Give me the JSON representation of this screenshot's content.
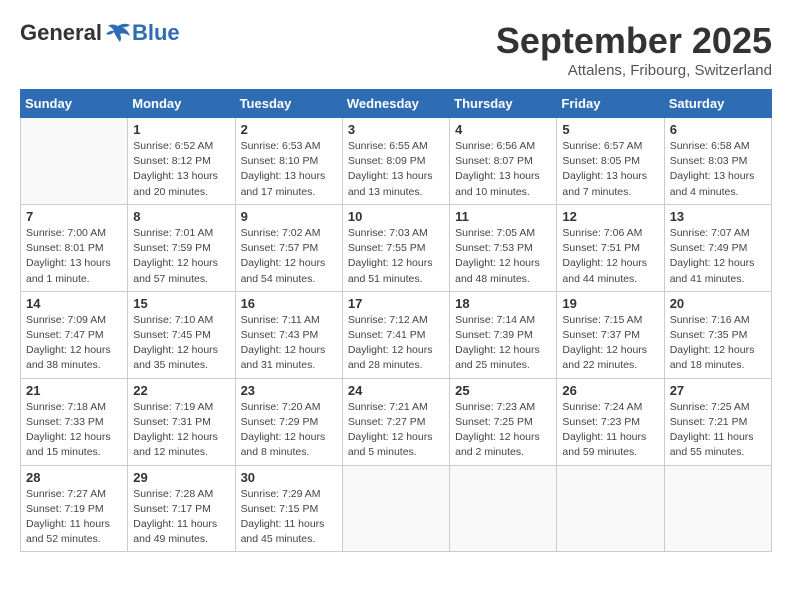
{
  "logo": {
    "general": "General",
    "blue": "Blue"
  },
  "title": "September 2025",
  "subtitle": "Attalens, Fribourg, Switzerland",
  "days_of_week": [
    "Sunday",
    "Monday",
    "Tuesday",
    "Wednesday",
    "Thursday",
    "Friday",
    "Saturday"
  ],
  "weeks": [
    [
      {
        "day": "",
        "info": ""
      },
      {
        "day": "1",
        "info": "Sunrise: 6:52 AM\nSunset: 8:12 PM\nDaylight: 13 hours\nand 20 minutes."
      },
      {
        "day": "2",
        "info": "Sunrise: 6:53 AM\nSunset: 8:10 PM\nDaylight: 13 hours\nand 17 minutes."
      },
      {
        "day": "3",
        "info": "Sunrise: 6:55 AM\nSunset: 8:09 PM\nDaylight: 13 hours\nand 13 minutes."
      },
      {
        "day": "4",
        "info": "Sunrise: 6:56 AM\nSunset: 8:07 PM\nDaylight: 13 hours\nand 10 minutes."
      },
      {
        "day": "5",
        "info": "Sunrise: 6:57 AM\nSunset: 8:05 PM\nDaylight: 13 hours\nand 7 minutes."
      },
      {
        "day": "6",
        "info": "Sunrise: 6:58 AM\nSunset: 8:03 PM\nDaylight: 13 hours\nand 4 minutes."
      }
    ],
    [
      {
        "day": "7",
        "info": "Sunrise: 7:00 AM\nSunset: 8:01 PM\nDaylight: 13 hours\nand 1 minute."
      },
      {
        "day": "8",
        "info": "Sunrise: 7:01 AM\nSunset: 7:59 PM\nDaylight: 12 hours\nand 57 minutes."
      },
      {
        "day": "9",
        "info": "Sunrise: 7:02 AM\nSunset: 7:57 PM\nDaylight: 12 hours\nand 54 minutes."
      },
      {
        "day": "10",
        "info": "Sunrise: 7:03 AM\nSunset: 7:55 PM\nDaylight: 12 hours\nand 51 minutes."
      },
      {
        "day": "11",
        "info": "Sunrise: 7:05 AM\nSunset: 7:53 PM\nDaylight: 12 hours\nand 48 minutes."
      },
      {
        "day": "12",
        "info": "Sunrise: 7:06 AM\nSunset: 7:51 PM\nDaylight: 12 hours\nand 44 minutes."
      },
      {
        "day": "13",
        "info": "Sunrise: 7:07 AM\nSunset: 7:49 PM\nDaylight: 12 hours\nand 41 minutes."
      }
    ],
    [
      {
        "day": "14",
        "info": "Sunrise: 7:09 AM\nSunset: 7:47 PM\nDaylight: 12 hours\nand 38 minutes."
      },
      {
        "day": "15",
        "info": "Sunrise: 7:10 AM\nSunset: 7:45 PM\nDaylight: 12 hours\nand 35 minutes."
      },
      {
        "day": "16",
        "info": "Sunrise: 7:11 AM\nSunset: 7:43 PM\nDaylight: 12 hours\nand 31 minutes."
      },
      {
        "day": "17",
        "info": "Sunrise: 7:12 AM\nSunset: 7:41 PM\nDaylight: 12 hours\nand 28 minutes."
      },
      {
        "day": "18",
        "info": "Sunrise: 7:14 AM\nSunset: 7:39 PM\nDaylight: 12 hours\nand 25 minutes."
      },
      {
        "day": "19",
        "info": "Sunrise: 7:15 AM\nSunset: 7:37 PM\nDaylight: 12 hours\nand 22 minutes."
      },
      {
        "day": "20",
        "info": "Sunrise: 7:16 AM\nSunset: 7:35 PM\nDaylight: 12 hours\nand 18 minutes."
      }
    ],
    [
      {
        "day": "21",
        "info": "Sunrise: 7:18 AM\nSunset: 7:33 PM\nDaylight: 12 hours\nand 15 minutes."
      },
      {
        "day": "22",
        "info": "Sunrise: 7:19 AM\nSunset: 7:31 PM\nDaylight: 12 hours\nand 12 minutes."
      },
      {
        "day": "23",
        "info": "Sunrise: 7:20 AM\nSunset: 7:29 PM\nDaylight: 12 hours\nand 8 minutes."
      },
      {
        "day": "24",
        "info": "Sunrise: 7:21 AM\nSunset: 7:27 PM\nDaylight: 12 hours\nand 5 minutes."
      },
      {
        "day": "25",
        "info": "Sunrise: 7:23 AM\nSunset: 7:25 PM\nDaylight: 12 hours\nand 2 minutes."
      },
      {
        "day": "26",
        "info": "Sunrise: 7:24 AM\nSunset: 7:23 PM\nDaylight: 11 hours\nand 59 minutes."
      },
      {
        "day": "27",
        "info": "Sunrise: 7:25 AM\nSunset: 7:21 PM\nDaylight: 11 hours\nand 55 minutes."
      }
    ],
    [
      {
        "day": "28",
        "info": "Sunrise: 7:27 AM\nSunset: 7:19 PM\nDaylight: 11 hours\nand 52 minutes."
      },
      {
        "day": "29",
        "info": "Sunrise: 7:28 AM\nSunset: 7:17 PM\nDaylight: 11 hours\nand 49 minutes."
      },
      {
        "day": "30",
        "info": "Sunrise: 7:29 AM\nSunset: 7:15 PM\nDaylight: 11 hours\nand 45 minutes."
      },
      {
        "day": "",
        "info": ""
      },
      {
        "day": "",
        "info": ""
      },
      {
        "day": "",
        "info": ""
      },
      {
        "day": "",
        "info": ""
      }
    ]
  ]
}
